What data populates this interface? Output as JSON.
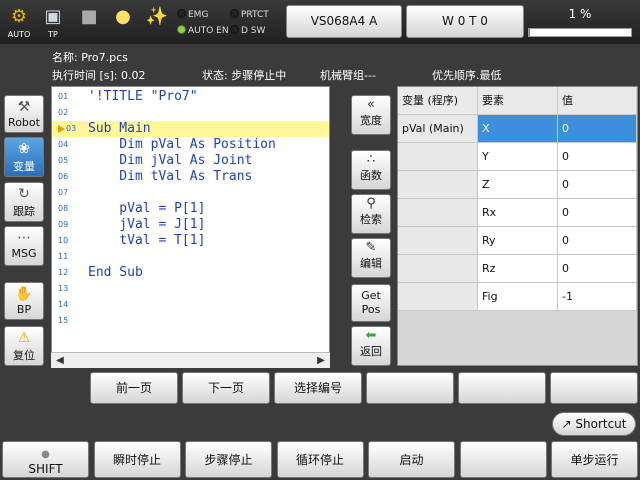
{
  "topbar": {
    "auto_label": "AUTO",
    "tp_label": "TP",
    "lamps": {
      "emg": "EMG",
      "prtct": "PRTCT",
      "auto_en": "AUTO EN",
      "dsw": "D SW"
    },
    "robot_button": "VS068A4 A",
    "tool_button": "W 0 T 0",
    "progress_text": "1 %",
    "progress_value": 0.01
  },
  "info": {
    "name_label": "名称: Pro7.pcs",
    "exec_time": "执行时间 [s]: 0.02",
    "status": "状态: 步骤停止中",
    "arm_group": "机械臂组---",
    "priority": "优先顺序.最低"
  },
  "leftnav": [
    "Robot",
    "变量",
    "跟踪",
    "MSG",
    "BP",
    "复位"
  ],
  "editor": {
    "lines": [
      {
        "num": "01",
        "code": "'!TITLE \"Pro7\""
      },
      {
        "num": "02",
        "code": ""
      },
      {
        "num": "03",
        "code": "Sub Main"
      },
      {
        "num": "04",
        "code": "    Dim pVal As Position"
      },
      {
        "num": "05",
        "code": "    Dim jVal As Joint"
      },
      {
        "num": "06",
        "code": "    Dim tVal As Trans"
      },
      {
        "num": "07",
        "code": ""
      },
      {
        "num": "08",
        "code": "    pVal = P[1]"
      },
      {
        "num": "09",
        "code": "    jVal = J[1]"
      },
      {
        "num": "10",
        "code": "    tVal = T[1]"
      },
      {
        "num": "11",
        "code": ""
      },
      {
        "num": "12",
        "code": "End Sub"
      },
      {
        "num": "13",
        "code": ""
      },
      {
        "num": "14",
        "code": ""
      },
      {
        "num": "15",
        "code": ""
      }
    ],
    "current_line": "03"
  },
  "midbuttons": [
    "宽度",
    "函数",
    "检索",
    "编辑",
    "Get Pos",
    "返回"
  ],
  "vartable": {
    "headers": [
      "变量 (程序)",
      "要素",
      "值"
    ],
    "variable": "pVal (Main)",
    "rows": [
      {
        "elem": "X",
        "value": "0"
      },
      {
        "elem": "Y",
        "value": "0"
      },
      {
        "elem": "Z",
        "value": "0"
      },
      {
        "elem": "Rx",
        "value": "0"
      },
      {
        "elem": "Ry",
        "value": "0"
      },
      {
        "elem": "Rz",
        "value": "0"
      },
      {
        "elem": "Fig",
        "value": "-1"
      }
    ]
  },
  "funcrow": [
    "前一页",
    "下一页",
    "选择编号",
    "",
    "",
    ""
  ],
  "shortcut": "Shortcut",
  "bottomrow": [
    "SHIFT",
    "瞬时停止",
    "步骤停止",
    "循环停止",
    "启动",
    "",
    "单步运行"
  ]
}
